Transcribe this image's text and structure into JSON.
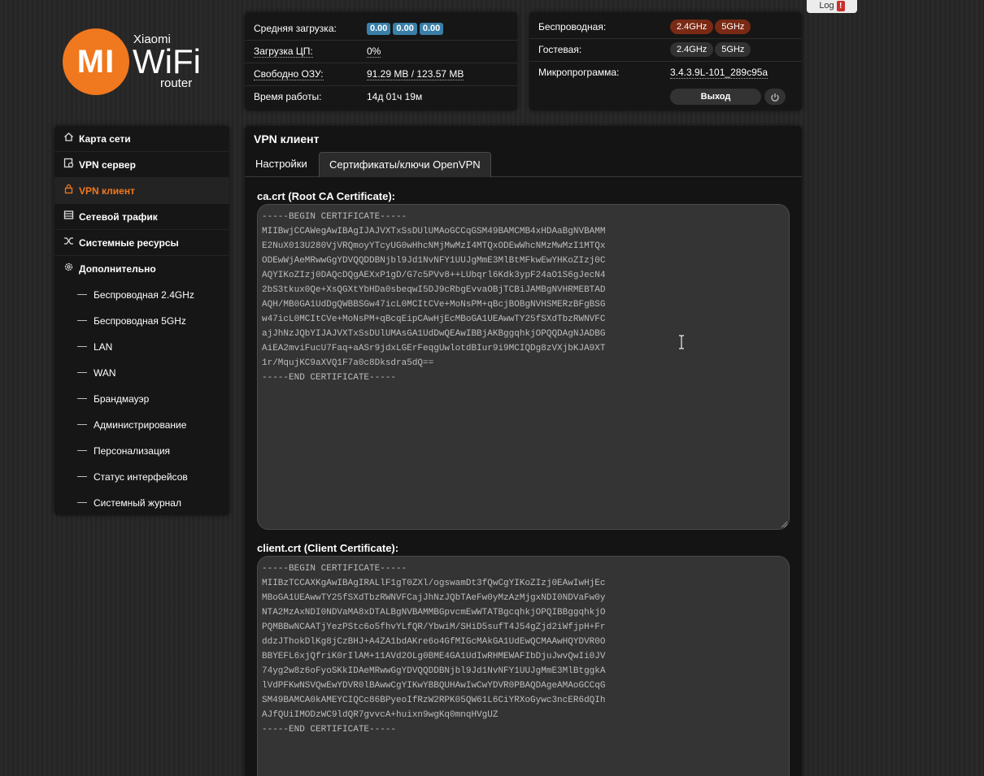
{
  "log_button": {
    "label": "Log",
    "count": "!"
  },
  "logo": {
    "mi": "MI",
    "brand": "Xiaomi",
    "wifi": "WiFi",
    "router": "router"
  },
  "status": {
    "load_label": "Средняя загрузка:",
    "load_values": [
      "0.00",
      "0.00",
      "0.00"
    ],
    "cpu_label": "Загрузка ЦП:",
    "cpu_value": "0%",
    "ram_label": "Свободно ОЗУ:",
    "ram_value": "91.29 MB / 123.57 MB",
    "uptime_label": "Время работы:",
    "uptime_value": "14д 01ч 19м"
  },
  "wireless": {
    "wireless_label": "Беспроводная:",
    "wireless_bands": [
      "2.4GHz",
      "5GHz"
    ],
    "guest_label": "Гостевая:",
    "guest_bands": [
      "2.4GHz",
      "5GHz"
    ],
    "firmware_label": "Микропрограмма:",
    "firmware_value": "3.4.3.9L-101_289c95a",
    "exit_label": "Выход",
    "band_on_color": "#7a2a14",
    "band_off_color": "#323232"
  },
  "menu": {
    "items": [
      {
        "label": "Карта сети",
        "icon": "home-icon"
      },
      {
        "label": "VPN сервер",
        "icon": "vpn-server-icon"
      },
      {
        "label": "VPN клиент",
        "icon": "vpn-client-icon",
        "active": true
      },
      {
        "label": "Сетевой трафик",
        "icon": "traffic-icon"
      },
      {
        "label": "Системные ресурсы",
        "icon": "shuffle-icon"
      },
      {
        "label": "Дополнительно",
        "icon": "gear-icon"
      }
    ],
    "sub_items": [
      "Беспроводная 2.4GHz",
      "Беспроводная 5GHz",
      "LAN",
      "WAN",
      "Брандмауэр",
      "Администрирование",
      "Персонализация",
      "Статус интерфейсов",
      "Системный журнал"
    ],
    "accent_color": "#f0781e"
  },
  "main": {
    "title": "VPN клиент",
    "tabs": [
      "Настройки",
      "Сертификаты/ключи OpenVPN"
    ],
    "active_tab": 1,
    "ca_label": "ca.crt (Root CA Certificate):",
    "ca_text": "-----BEGIN CERTIFICATE-----\nMIIBwjCCAWegAwIBAgIJAJVXTxSsDUlUMAoGCCqGSM49BAMCMB4xHDAaBgNVBAMM\nE2NuX013U280VjVRQmoyYTcyUG0wHhcNMjMwMzI4MTQxODEwWhcNMzMwMzI1MTQx\nODEwWjAeMRwwGgYDVQQDDBNjbl9Jd1NvNFY1UUJgMmE3MlBtMFkwEwYHKoZIzj0C\nAQYIKoZIzj0DAQcDQgAEXxP1gD/G7c5PVv8++LUbqrl6Kdk3ypF24aO1S6gJecN4\n2bS3tkux0Qe+XsQGXtYbHDa0sbeqwI5DJ9cRbgEvvaOBjTCBiJAMBgNVHRMEBTAD\nAQH/MB0GA1UdDgQWBBSGw47icL0MCItCVe+MoNsPM+qBcjBOBgNVHSMERzBFgBSG\nw47icL0MCItCVe+MoNsPM+qBcqEipCAwHjEcMBoGA1UEAwwTY25fSXdTbzRWNVFC\najJhNzJQbYIJAJVXTxSsDUlUMAsGA1UdDwQEAwIBBjAKBggqhkjOPQQDAgNJADBG\nAiEA2mviFucU7Faq+aASr9jdxLGErFeqgUwlotdBIur9i9MCIQDg8zVXjbKJA9XT\n1r/MqujKC9aXVQ1F7a0c8Dksdra5dQ==\n-----END CERTIFICATE-----",
    "client_label": "client.crt (Client Certificate):",
    "client_text": "-----BEGIN CERTIFICATE-----\nMIIBzTCCAXKgAwIBAgIRALlF1gT0ZXl/ogswamDt3fQwCgYIKoZIzj0EAwIwHjEc\nMBoGA1UEAwwTY25fSXdTbzRWNVFCajJhNzJQbTAeFw0yMzAzMjgxNDI0NDVaFw0y\nNTA2MzAxNDI0NDVaMA8xDTALBgNVBAMMBGpvcmEwWTATBgcqhkjOPQIBBggqhkjO\nPQMBBwNCAATjYezPStc6o5fhvYLfQR/YbwiM/SHiD5sufT4J54gZjd2iWfjpH+Fr\nddzJThokDlKg8jCzBHJ+A4ZA1bdAKre6o4GfMIGcMAkGA1UdEwQCMAAwHQYDVR0O\nBBYEFL6xjQfriK0rIlAM+11AVd2OLg0BME4GA1UdIwRHMEWAFIbDjuJwvQwIi0JV\n74yg2w8z6oFyoSKkIDAeMRwwGgYDVQQDDBNjbl9Jd1NvNFY1UUJgMmE3MlBtggkA\nlVdPFKwNSVQwEwYDVR0lBAwwCgYIKwYBBQUHAwIwCwYDVR0PBAQDAgeAMAoGCCqG\nSM49BAMCA0kAMEYCIQCc86BPyeoIfRzW2RPK05QW61L6CiYRXoGywc3ncER6dQIh\nAJfQUiIMODzWC9ldQR7gvvcA+huixn9wgKq0mnqHVgUZ\n-----END CERTIFICATE-----"
  }
}
